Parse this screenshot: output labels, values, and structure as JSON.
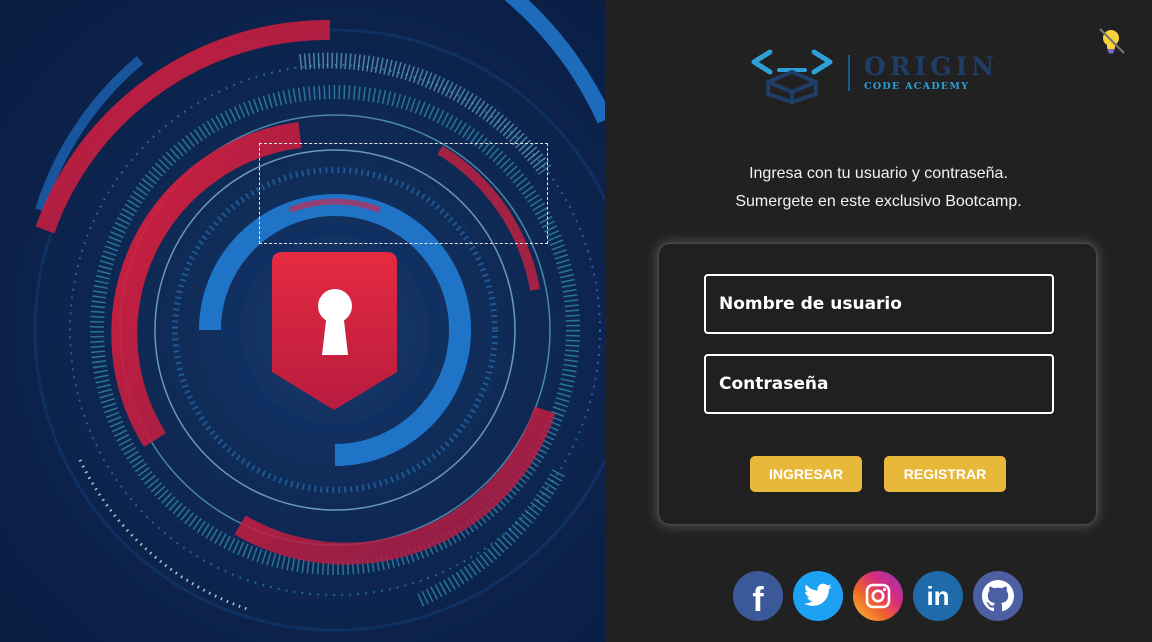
{
  "hero": {
    "graphic": "padlock-keyhole-shield"
  },
  "theme_toggle": {
    "icon": "lightbulb-off-icon"
  },
  "brand": {
    "title": "ORIGIN",
    "subtitle": "CODE ACADEMY",
    "logo_icon": "code-brackets-box-icon"
  },
  "intro": {
    "line1": "Ingresa con tu usuario y contraseña.",
    "line2": "Sumergete en este exclusivo Bootcamp."
  },
  "login_form": {
    "username_placeholder": "Nombre de usuario",
    "password_placeholder": "Contraseña",
    "login_label": "INGRESAR",
    "register_label": "REGISTRAR"
  },
  "socials": [
    {
      "icon": "facebook-icon",
      "text": "f"
    },
    {
      "icon": "twitter-icon"
    },
    {
      "icon": "instagram-icon"
    },
    {
      "icon": "linkedin-icon",
      "text": "in"
    },
    {
      "icon": "github-icon"
    }
  ],
  "colors": {
    "accent": "#e8b83b",
    "panel_bg": "#212121",
    "hero_bg": "#0b2149",
    "hero_red": "#e0203d",
    "hero_blue": "#1f74c8",
    "hero_cyan": "#3fb6d8"
  }
}
